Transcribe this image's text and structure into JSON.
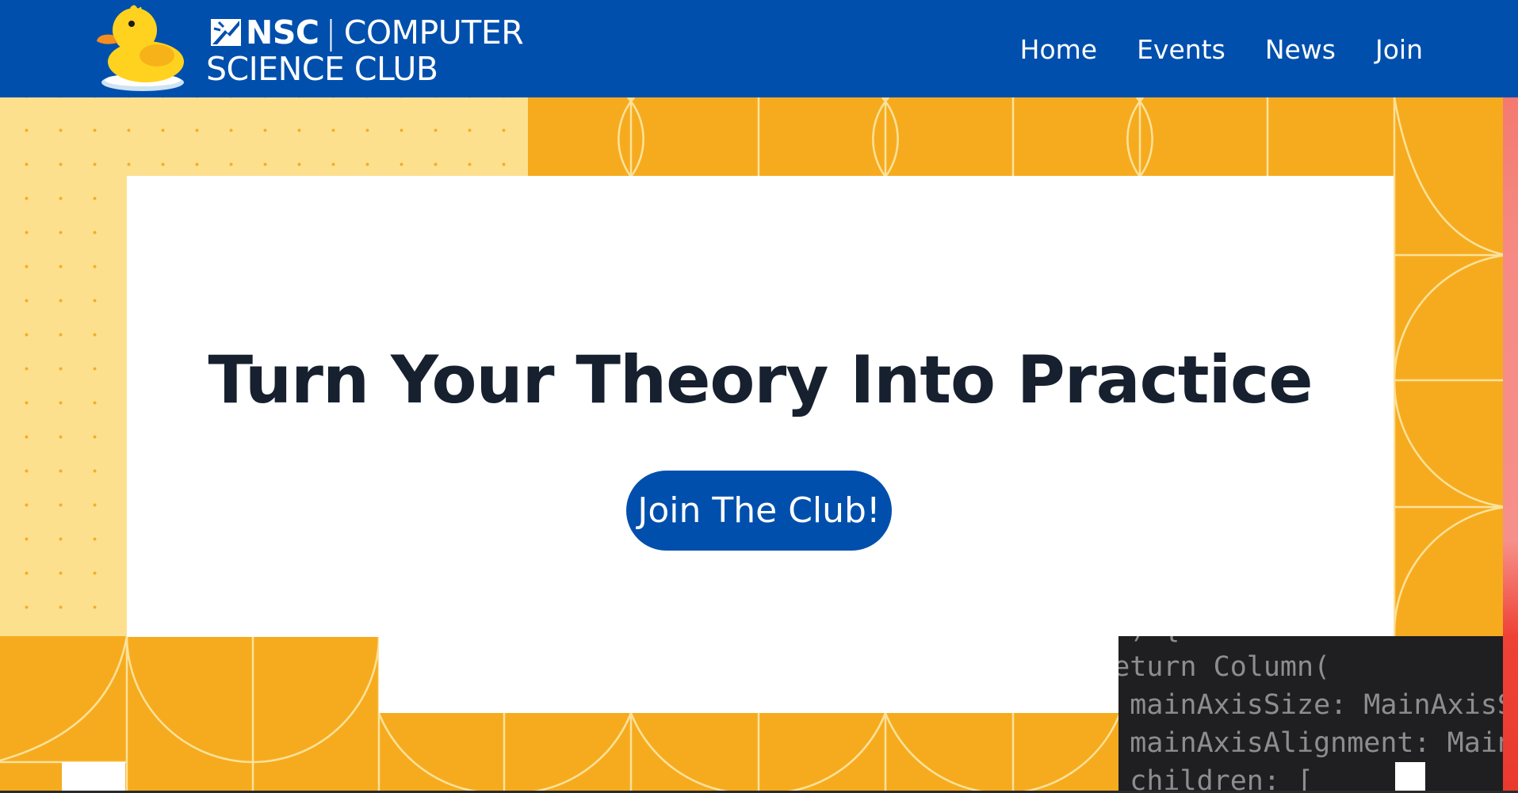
{
  "header": {
    "logo": {
      "line1_bold": "NSC",
      "separator": "|",
      "line1_rest": "COMPUTER",
      "line2": "SCIENCE CLUB",
      "mascot_icon": "rubber-duck-icon",
      "mark_icon": "nsc-emblem-icon"
    },
    "nav": [
      {
        "label": "Home"
      },
      {
        "label": "Events"
      },
      {
        "label": "News"
      },
      {
        "label": "Join"
      }
    ]
  },
  "hero": {
    "title": "Turn Your Theory Into Practice",
    "cta_label": "Join The Club!"
  },
  "code_snippet": {
    "lines": [
      "    ) {",
      "  return Column(",
      "    mainAxisSize: MainAxisSize.min,",
      "    mainAxisAlignment: MainAxisAlignment.center,",
      "    children: ["
    ]
  },
  "colors": {
    "header_bg": "#004fad",
    "accent_yellow": "#f6ab1f",
    "light_yellow": "#fde08e",
    "title_text": "#16202f",
    "cta_bg": "#004fad",
    "code_bg": "#1f1f22"
  }
}
